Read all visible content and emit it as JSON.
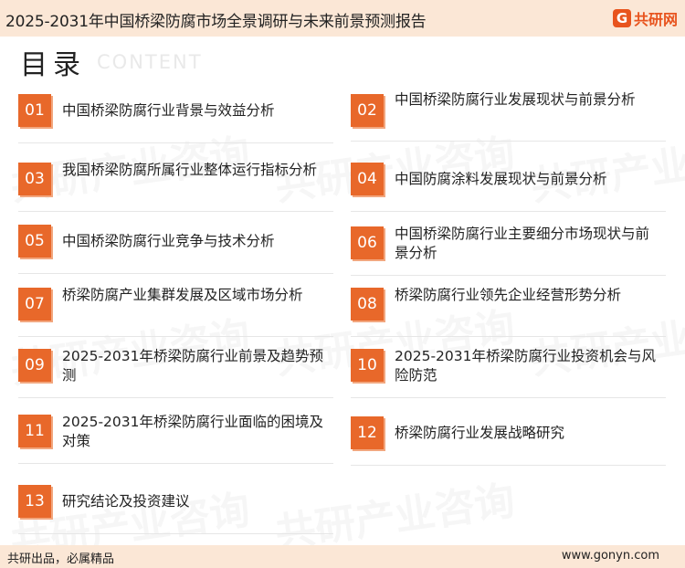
{
  "header": {
    "title": "2025-2031年中国桥梁防腐市场全景调研与未来前景预测报告",
    "logo_mark": "G",
    "logo_text": "共研网"
  },
  "toc": {
    "heading": "目录",
    "heading_en": "CONTENT",
    "items": [
      {
        "num": "01",
        "text": "中国桥梁防腐行业背景与效益分析"
      },
      {
        "num": "02",
        "text": "中国桥梁防腐行业发展现状与前景分析"
      },
      {
        "num": "03",
        "text": "我国桥梁防腐所属行业整体运行指标分析"
      },
      {
        "num": "04",
        "text": "中国防腐涂料发展现状与前景分析"
      },
      {
        "num": "05",
        "text": "中国桥梁防腐行业竞争与技术分析"
      },
      {
        "num": "06",
        "text": "中国桥梁防腐行业主要细分市场现状与前景分析"
      },
      {
        "num": "07",
        "text": "桥梁防腐产业集群发展及区域市场分析"
      },
      {
        "num": "08",
        "text": "桥梁防腐行业领先企业经营形势分析"
      },
      {
        "num": "09",
        "text": "2025-2031年桥梁防腐行业前景及趋势预测"
      },
      {
        "num": "10",
        "text": "2025-2031年桥梁防腐行业投资机会与风险防范"
      },
      {
        "num": "11",
        "text": "2025-2031年桥梁防腐行业面临的困境及对策"
      },
      {
        "num": "12",
        "text": "桥梁防腐行业发展战略研究"
      },
      {
        "num": "13",
        "text": "研究结论及投资建议"
      }
    ]
  },
  "watermark": {
    "text": "共研产业咨询"
  },
  "footer": {
    "slogan": "共研出品，必属精品",
    "website": "www.gonyn.com"
  }
}
